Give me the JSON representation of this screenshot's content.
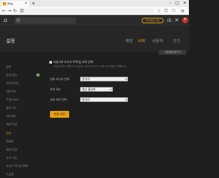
{
  "browser": {
    "tab_title": "Plex",
    "new_tab": "+",
    "url": "",
    "window_controls": [
      "–",
      "□",
      "✕"
    ]
  },
  "plex": {
    "premium_label": "프리미엄 가입",
    "avatar_letter": "P"
  },
  "settings": {
    "title": "설정",
    "tabs": [
      {
        "label": "계정"
      },
      {
        "label": "서버"
      },
      {
        "label": "사용자"
      },
      {
        "label": "기기"
      }
    ],
    "active_tab": 1,
    "advanced_button": "고급설정 숨기기"
  },
  "sidebar": {
    "items": [
      {
        "label": "일반"
      },
      {
        "label": "원격 접속"
      },
      {
        "label": "라이브러리"
      },
      {
        "label": "네트워크"
      },
      {
        "label": "트랜스코더"
      },
      {
        "label": "플러그인"
      },
      {
        "label": "대시보드"
      },
      {
        "label": "예약 작업"
      },
      {
        "label": "언어"
      },
      {
        "label": "DLNA"
      },
      {
        "label": "예약 작업"
      },
      {
        "label": "추가 기능"
      },
      {
        "label": "라이브 TV 및 DVR"
      },
      {
        "label": "도움말"
      }
    ],
    "active_index": 8
  },
  "language": {
    "auto_select_label": "자동으로 오디오 트랙 및 자막 선택",
    "help_text": "가능한 경우 사용자가 선호하는 언어의 오디오 트랙 및 자막을 선택합니다.",
    "audio_label": "선호 오디오 언어",
    "audio_value": "한국어",
    "subtitle_mode_label": "자막 모드",
    "subtitle_mode_value": "항상 활성화",
    "subtitle_lang_label": "선호 자막 언어",
    "subtitle_lang_value": "한국어",
    "save_label": "변경 저장"
  },
  "colors": {
    "accent": "#e5a00d",
    "background": "#1f1f1f"
  }
}
